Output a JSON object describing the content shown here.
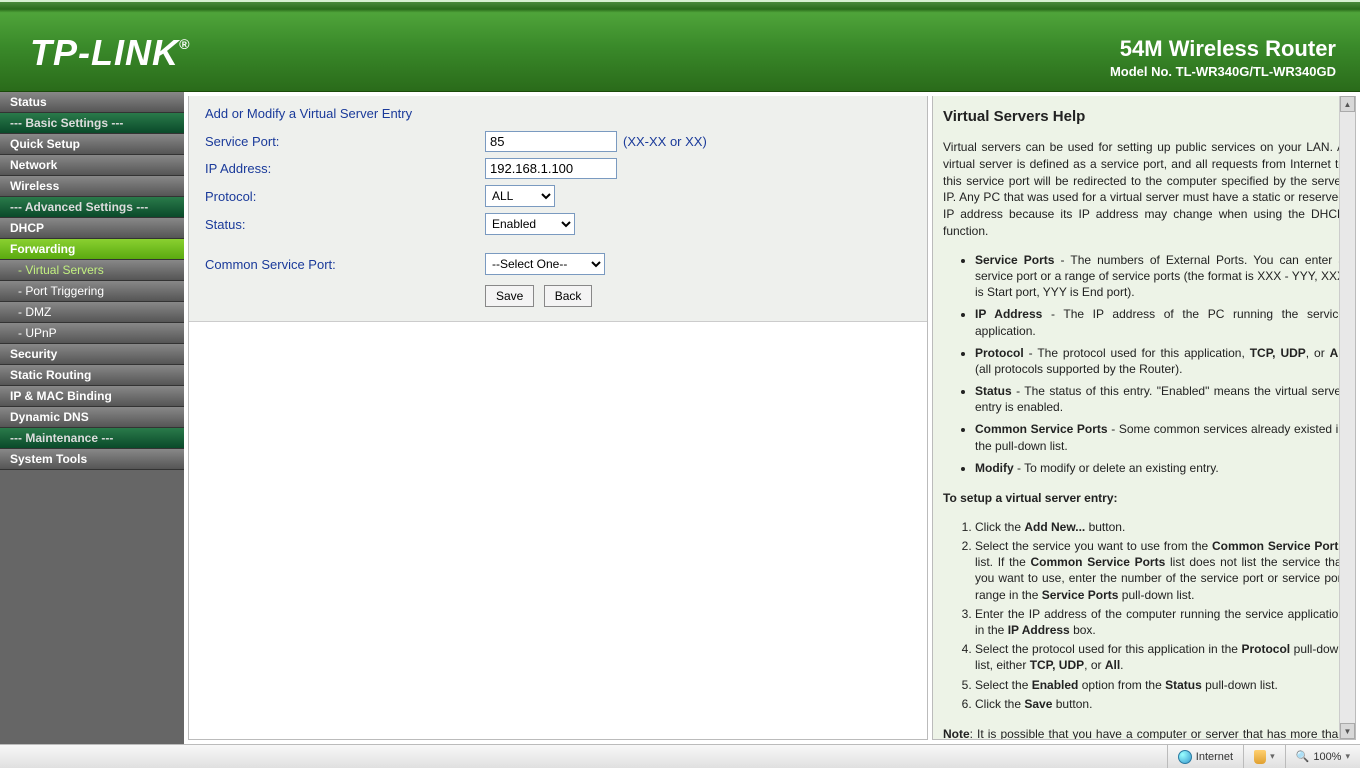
{
  "banner": {
    "logo": "TP-LINK",
    "title": "54M Wireless Router",
    "model": "Model No. TL-WR340G/TL-WR340GD"
  },
  "nav": {
    "status": "Status",
    "basic": "--- Basic Settings ---",
    "quick": "Quick Setup",
    "network": "Network",
    "wireless": "Wireless",
    "advanced": "--- Advanced Settings ---",
    "dhcp": "DHCP",
    "forwarding": "Forwarding",
    "virtual": "- Virtual Servers",
    "porttrig": "- Port Triggering",
    "dmz": "- DMZ",
    "upnp": "- UPnP",
    "security": "Security",
    "static": "Static Routing",
    "ipmac": "IP & MAC Binding",
    "ddns": "Dynamic DNS",
    "maint": "--- Maintenance ---",
    "system": "System Tools"
  },
  "form": {
    "title": "Add or Modify a Virtual Server Entry",
    "service_label": "Service Port:",
    "service_value": "85",
    "service_hint": "(XX-XX or XX)",
    "ip_label": "IP Address:",
    "ip_value": "192.168.1.100",
    "protocol_label": "Protocol:",
    "protocol_value": "ALL",
    "status_label": "Status:",
    "status_value": "Enabled",
    "common_label": "Common Service Port:",
    "common_value": "--Select One--",
    "save": "Save",
    "back": "Back"
  },
  "help": {
    "title": "Virtual Servers Help",
    "intro": "Virtual servers can be used for setting up public services on your LAN. A virtual server is defined as a service port, and all requests from Internet to this service port will be redirected to the computer specified by the server IP. Any PC that was used for a virtual server must have a static or reserved IP address because its IP address may change when using the DHCP function.",
    "b1_k": "Service Ports",
    "b1_v": " - The numbers of External Ports. You can enter a service port or a range of service ports (the format is XXX - YYY, XXX is Start port, YYY is End port).",
    "b2_k": "IP Address",
    "b2_v": " - The IP address of the PC running the service application.",
    "b3_k": "Protocol",
    "b3_v": " - The protocol used for this application, ",
    "b3_tcp": "TCP, UDP",
    "b3_or": ", or ",
    "b3_all": "All",
    "b3_end": " (all protocols supported by the Router).",
    "b4_k": "Status",
    "b4_v": " - The status of this entry. \"Enabled\" means the virtual server entry is enabled.",
    "b5_k": "Common Service Ports",
    "b5_v": " - Some common services already existed in the pull-down list.",
    "b6_k": "Modify",
    "b6_v": " - To modify or delete an existing entry.",
    "setup": "To setup a virtual server entry:",
    "s1a": "Click the ",
    "s1b": "Add New...",
    "s1c": " button.",
    "s2a": "Select the service you want to use from the ",
    "s2b": "Common Service Ports",
    "s2c": " list. If the ",
    "s2d": "Common Service Ports",
    "s2e": " list does not list the service that you want to use, enter the number of the service port or service port range in the ",
    "s2f": "Service Ports",
    "s2g": " pull-down list.",
    "s3a": "Enter the IP address of the computer running the service application in the ",
    "s3b": "IP Address",
    "s3c": " box.",
    "s4a": "Select the protocol used for this application in the ",
    "s4b": "Protocol",
    "s4c": " pull-down list, either ",
    "s4d": "TCP, UDP",
    "s4e": ", or ",
    "s4f": "All",
    "s4g": ".",
    "s5a": "Select the ",
    "s5b": "Enabled",
    "s5c": " option from the ",
    "s5d": "Status",
    "s5e": " pull-down list.",
    "s6a": "Click the ",
    "s6b": "Save",
    "s6c": " button.",
    "note_k": "Note",
    "note_v": ": It is possible that you have a computer or server that has more than one type of available service. If so, select another service, and type the"
  },
  "statusbar": {
    "internet": "Internet",
    "zoom": "100%"
  }
}
